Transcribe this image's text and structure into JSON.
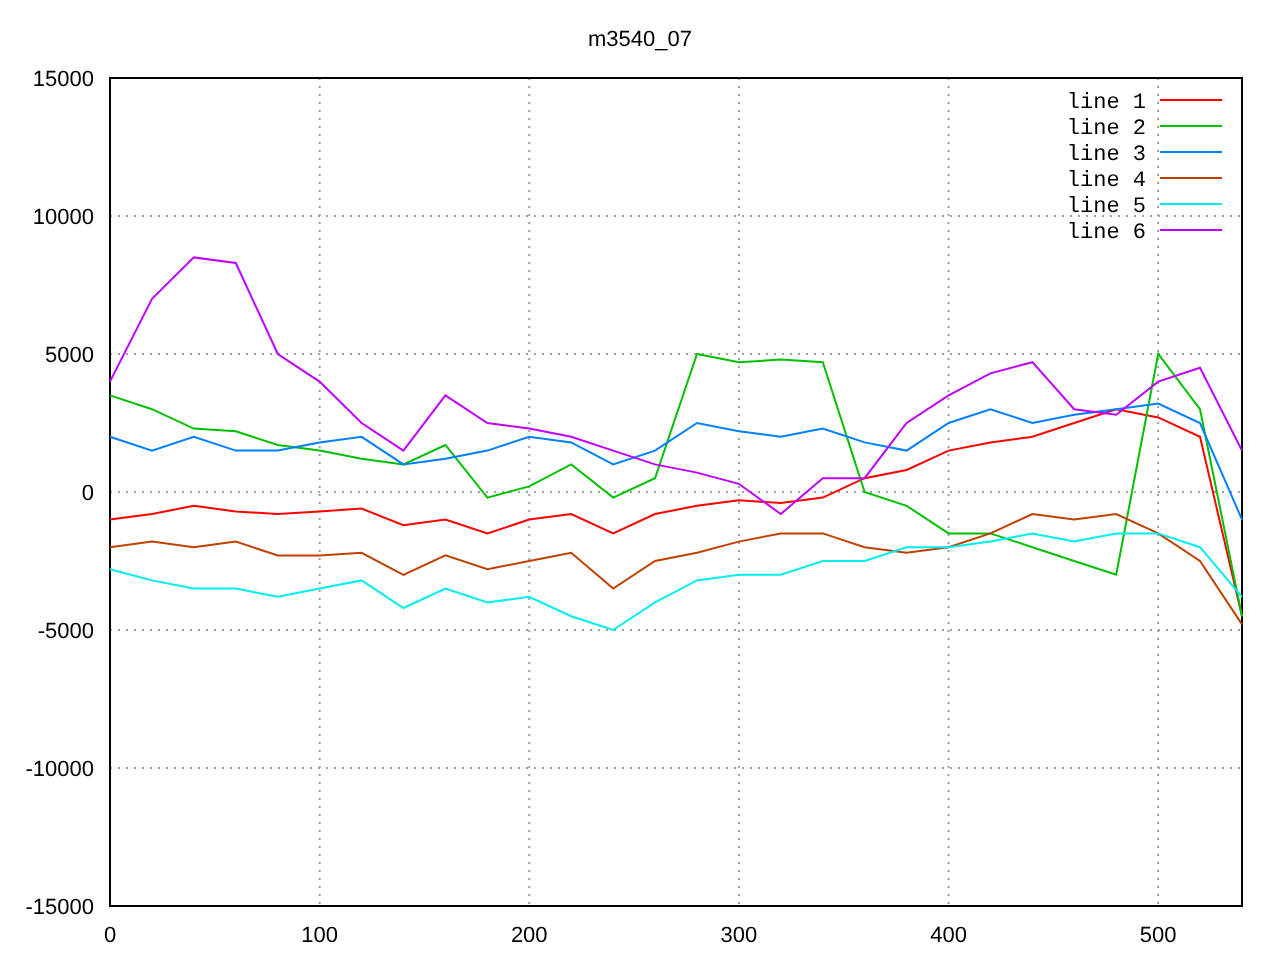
{
  "chart_data": {
    "type": "line",
    "title": "m3540_07",
    "x": [
      0,
      20,
      40,
      60,
      80,
      100,
      120,
      140,
      160,
      180,
      200,
      220,
      240,
      260,
      280,
      300,
      320,
      340,
      360,
      380,
      400,
      420,
      440,
      460,
      480,
      500,
      520,
      540
    ],
    "xlim": [
      0,
      540
    ],
    "ylim": [
      -15000,
      15000
    ],
    "grid": true,
    "legend": true,
    "xticks": [
      0,
      100,
      200,
      300,
      400,
      500
    ],
    "yticks": [
      -15000,
      -10000,
      -5000,
      0,
      5000,
      10000,
      15000
    ],
    "series": [
      {
        "name": "line 1",
        "color": "#ff0000",
        "values": [
          -1000,
          -800,
          -500,
          -700,
          -800,
          -700,
          -600,
          -1200,
          -1000,
          -1500,
          -1000,
          -800,
          -1500,
          -800,
          -500,
          -300,
          -400,
          -200,
          500,
          800,
          1500,
          1800,
          2000,
          2500,
          3000,
          2700,
          2000,
          -4500
        ]
      },
      {
        "name": "line 2",
        "color": "#00c000",
        "values": [
          3500,
          3000,
          2300,
          2200,
          1700,
          1500,
          1200,
          1000,
          1700,
          -200,
          200,
          1000,
          -200,
          500,
          5000,
          4700,
          4800,
          4700,
          0,
          -500,
          -1500,
          -1500,
          -2000,
          -2500,
          -3000,
          5000,
          3000,
          -4500
        ]
      },
      {
        "name": "line 3",
        "color": "#0080ff",
        "values": [
          2000,
          1500,
          2000,
          1500,
          1500,
          1800,
          2000,
          1000,
          1200,
          1500,
          2000,
          1800,
          1000,
          1500,
          2500,
          2200,
          2000,
          2300,
          1800,
          1500,
          2500,
          3000,
          2500,
          2800,
          3000,
          3200,
          2500,
          -1000
        ]
      },
      {
        "name": "line 4",
        "color": "#c04000",
        "values": [
          -2000,
          -1800,
          -2000,
          -1800,
          -2300,
          -2300,
          -2200,
          -3000,
          -2300,
          -2800,
          -2500,
          -2200,
          -3500,
          -2500,
          -2200,
          -1800,
          -1500,
          -1500,
          -2000,
          -2200,
          -2000,
          -1500,
          -800,
          -1000,
          -800,
          -1500,
          -2500,
          -4800
        ]
      },
      {
        "name": "line 5",
        "color": "#00eeee",
        "values": [
          -2800,
          -3200,
          -3500,
          -3500,
          -3800,
          -3500,
          -3200,
          -4200,
          -3500,
          -4000,
          -3800,
          -4500,
          -5000,
          -4000,
          -3200,
          -3000,
          -3000,
          -2500,
          -2500,
          -2000,
          -2000,
          -1800,
          -1500,
          -1800,
          -1500,
          -1500,
          -2000,
          -3800
        ]
      },
      {
        "name": "line 6",
        "color": "#c000ff",
        "values": [
          4000,
          7000,
          8500,
          8300,
          5000,
          4000,
          2500,
          1500,
          3500,
          2500,
          2300,
          2000,
          1500,
          1000,
          700,
          300,
          -800,
          500,
          500,
          2500,
          3500,
          4300,
          4700,
          3000,
          2800,
          4000,
          4500,
          1500
        ]
      }
    ]
  }
}
